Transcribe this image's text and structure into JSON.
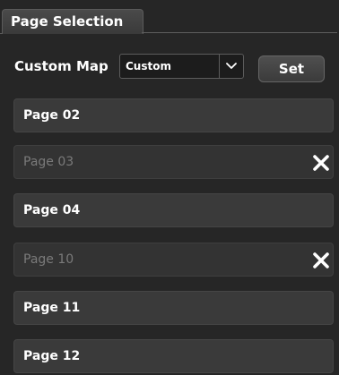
{
  "tab": {
    "label": "Page Selection"
  },
  "custom_map": {
    "label": "Custom Map",
    "select_value": "Custom",
    "set_label": "Set"
  },
  "pages": [
    {
      "label": "Page 02",
      "disabled": false
    },
    {
      "label": "Page 03",
      "disabled": true
    },
    {
      "label": "Page 04",
      "disabled": false
    },
    {
      "label": "Page 10",
      "disabled": true
    },
    {
      "label": "Page 11",
      "disabled": false
    },
    {
      "label": "Page 12",
      "disabled": false
    }
  ],
  "icons": {
    "dropdown": "chevron-down-icon",
    "remove": "close-icon"
  }
}
